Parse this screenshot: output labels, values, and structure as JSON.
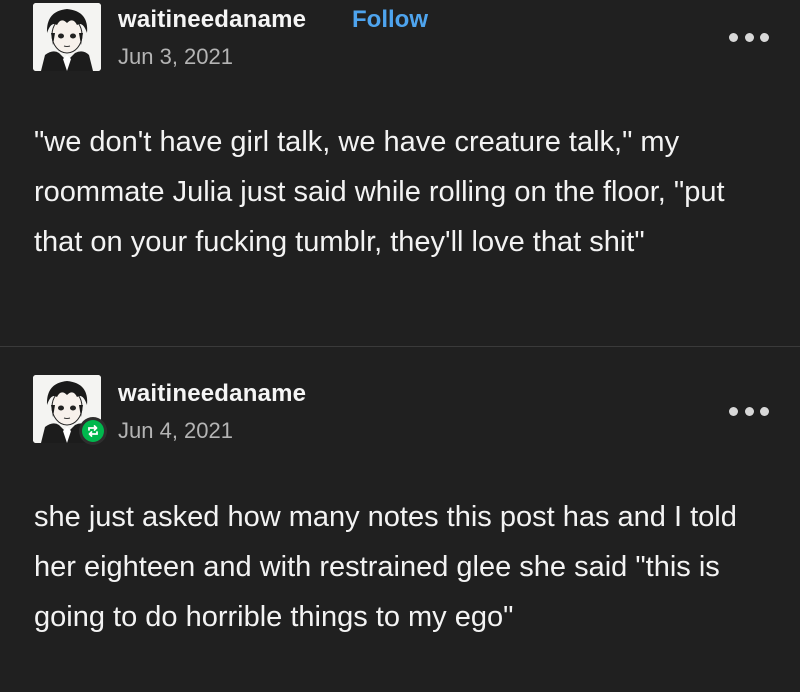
{
  "posts": [
    {
      "username": "waitineedaname",
      "follow_label": "Follow",
      "date": "Jun 3, 2021",
      "avatar_icon": "anime-boy-avatar-icon",
      "more_icon": "more-options-icon",
      "text": "\"we don't have girl talk, we have creature talk,\" my roommate Julia just said while rolling on the floor, \"put that on your fucking tumblr, they'll love that shit\""
    },
    {
      "username": "waitineedaname",
      "date": "Jun 4, 2021",
      "avatar_icon": "anime-boy-avatar-icon",
      "badge_icon": "reblog-icon",
      "more_icon": "more-options-icon",
      "text": "she just asked how many notes this post has and I told her eighteen and with restrained glee she said \"this is going to do horrible things to my ego\""
    }
  ],
  "colors": {
    "background": "#202020",
    "text": "#f3f3f3",
    "follow": "#4ea4ee",
    "date": "#b4b4b4",
    "reblog_badge": "#00b84d"
  }
}
